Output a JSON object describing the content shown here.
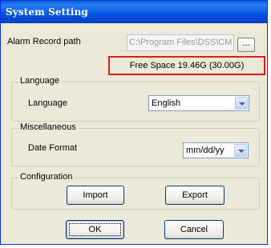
{
  "window": {
    "title": "System Setting"
  },
  "alarm": {
    "label": "Alarm Record path",
    "path_value": "C:\\Program Files\\DSS\\CM",
    "browse_label": "...",
    "free_space": "Free Space 19.46G (30.00G)"
  },
  "language_group": {
    "legend": "Language",
    "label": "Language",
    "selected": "English"
  },
  "misc_group": {
    "legend": "Miscellaneous",
    "label": "Date Format",
    "selected": "mm/dd/yy"
  },
  "config_group": {
    "legend": "Configuration",
    "import_label": "Import",
    "export_label": "Export"
  },
  "footer": {
    "ok_label": "OK",
    "cancel_label": "Cancel"
  },
  "colors": {
    "titlebar": "#0054e3",
    "highlight_border": "#e11c1c",
    "dialog_bg": "#ece9d8"
  }
}
